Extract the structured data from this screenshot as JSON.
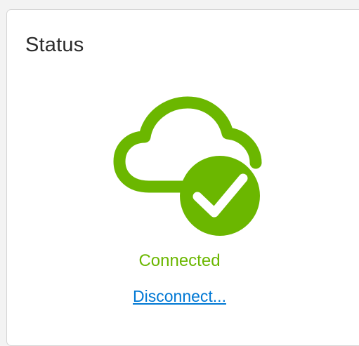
{
  "panel": {
    "title": "Status"
  },
  "status": {
    "state_label": "Connected",
    "icon": "cloud-connected-icon",
    "check_icon": "checkmark-icon"
  },
  "actions": {
    "disconnect_label": "Disconnect..."
  },
  "colors": {
    "success": "#6bb700",
    "link": "#0078d4",
    "title": "#2b2b2b",
    "card_border": "#d6d6d6",
    "background": "#f3f3f3"
  }
}
